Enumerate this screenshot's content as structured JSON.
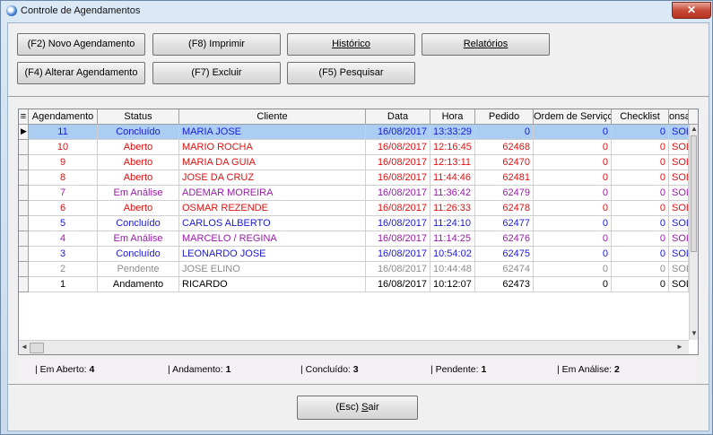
{
  "window": {
    "title": "Controle de Agendamentos",
    "close_label": "✕"
  },
  "toolbar": {
    "novo": "(F2) Novo Agendamento",
    "imprimir": "(F8) Imprimir",
    "historico": "Histórico",
    "relatorios": "Relatórios",
    "alterar": "(F4) Alterar Agendamento",
    "excluir": "(F7) Excluir",
    "pesquisar": "(F5) Pesquisar"
  },
  "grid": {
    "columns": [
      "Agendamento",
      "Status",
      "Cliente",
      "Data",
      "Hora",
      "Pedido",
      "Ordem de Serviço",
      "Checklist",
      "onsa"
    ],
    "rows": [
      {
        "agendamento": "11",
        "status": "Concluído",
        "cliente": "MARIA JOSE",
        "data": "16/08/2017",
        "hora": "13:33:29",
        "pedido": "0",
        "os": "0",
        "checklist": "0",
        "extra": "SOL",
        "color": "#1a1ad6",
        "selected": true
      },
      {
        "agendamento": "10",
        "status": "Aberto",
        "cliente": "MARIO ROCHA",
        "data": "16/08/2017",
        "hora": "12:16:45",
        "pedido": "62468",
        "os": "0",
        "checklist": "0",
        "extra": "SOL",
        "color": "#e01010",
        "selected": false
      },
      {
        "agendamento": "9",
        "status": "Aberto",
        "cliente": "MARIA DA GUIA",
        "data": "16/08/2017",
        "hora": "12:13:11",
        "pedido": "62470",
        "os": "0",
        "checklist": "0",
        "extra": "SOL",
        "color": "#e01010",
        "selected": false
      },
      {
        "agendamento": "8",
        "status": "Aberto",
        "cliente": "JOSE DA CRUZ",
        "data": "16/08/2017",
        "hora": "11:44:46",
        "pedido": "62481",
        "os": "0",
        "checklist": "0",
        "extra": "SOL",
        "color": "#e01010",
        "selected": false
      },
      {
        "agendamento": "7",
        "status": "Em Análise",
        "cliente": "ADEMAR MOREIRA",
        "data": "16/08/2017",
        "hora": "11:36:42",
        "pedido": "62479",
        "os": "0",
        "checklist": "0",
        "extra": "SOL",
        "color": "#9a1aa8",
        "selected": false
      },
      {
        "agendamento": "6",
        "status": "Aberto",
        "cliente": "OSMAR REZENDE",
        "data": "16/08/2017",
        "hora": "11:26:33",
        "pedido": "62478",
        "os": "0",
        "checklist": "0",
        "extra": "SOL",
        "color": "#e01010",
        "selected": false
      },
      {
        "agendamento": "5",
        "status": "Concluído",
        "cliente": "CARLOS ALBERTO",
        "data": "16/08/2017",
        "hora": "11:24:10",
        "pedido": "62477",
        "os": "0",
        "checklist": "0",
        "extra": "SOL",
        "color": "#1a1ad6",
        "selected": false
      },
      {
        "agendamento": "4",
        "status": "Em Análise",
        "cliente": "MARCELO / REGINA",
        "data": "16/08/2017",
        "hora": "11:14:25",
        "pedido": "62476",
        "os": "0",
        "checklist": "0",
        "extra": "SOL",
        "color": "#9a1aa8",
        "selected": false
      },
      {
        "agendamento": "3",
        "status": "Concluído",
        "cliente": "LEONARDO JOSE",
        "data": "16/08/2017",
        "hora": "10:54:02",
        "pedido": "62475",
        "os": "0",
        "checklist": "0",
        "extra": "SOL",
        "color": "#1a1ad6",
        "selected": false
      },
      {
        "agendamento": "2",
        "status": "Pendente",
        "cliente": "JOSE ELINO",
        "data": "16/08/2017",
        "hora": "10:44:48",
        "pedido": "62474",
        "os": "0",
        "checklist": "0",
        "extra": "SOL",
        "color": "#8c8c8c",
        "selected": false
      },
      {
        "agendamento": "1",
        "status": "Andamento",
        "cliente": "RICARDO",
        "data": "16/08/2017",
        "hora": "10:12:07",
        "pedido": "62473",
        "os": "0",
        "checklist": "0",
        "extra": "SOL",
        "color": "#000000",
        "selected": false
      }
    ]
  },
  "summary": [
    {
      "label": "| Em Aberto: ",
      "value": "4"
    },
    {
      "label": "| Andamento: ",
      "value": "1"
    },
    {
      "label": "| Concluído: ",
      "value": "3"
    },
    {
      "label": "| Pendente: ",
      "value": "1"
    },
    {
      "label": "| Em Análise: ",
      "value": "2"
    }
  ],
  "footer": {
    "sair_prefix": "(Esc) ",
    "sair_key": "S",
    "sair_rest": "air"
  }
}
